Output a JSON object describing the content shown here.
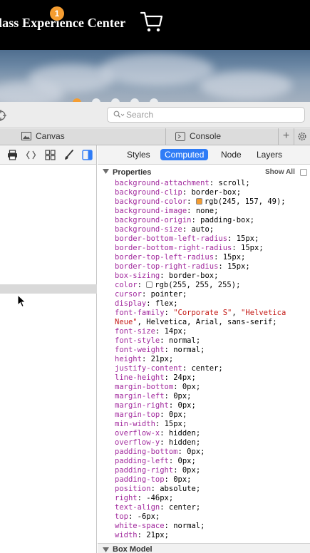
{
  "site": {
    "title": "lass Experience Center",
    "cart_count": "1",
    "cart_icon": "shopping-cart-icon",
    "accent_color": "#f59d31"
  },
  "hero": {
    "carousel_dots": 5,
    "active_dot": 0
  },
  "inspector": {
    "search_placeholder": "Search",
    "tabs": [
      {
        "label": "Canvas",
        "icon": "canvas-icon"
      },
      {
        "label": "Console",
        "icon": "console-icon"
      }
    ],
    "panel_tabs": [
      {
        "label": "Styles"
      },
      {
        "label": "Computed",
        "selected": true
      },
      {
        "label": "Node"
      },
      {
        "label": "Layers"
      }
    ],
    "properties_title": "Properties",
    "show_all_label": "Show All",
    "show_all_checked": false,
    "box_model_label": "Box Model"
  },
  "properties": [
    {
      "name": "background-attachment",
      "value": "scroll"
    },
    {
      "name": "background-clip",
      "value": "border-box"
    },
    {
      "name": "background-color",
      "value": "rgb(245, 157, 49)",
      "swatch": "#f59d31"
    },
    {
      "name": "background-image",
      "value": "none"
    },
    {
      "name": "background-origin",
      "value": "padding-box"
    },
    {
      "name": "background-size",
      "value": "auto"
    },
    {
      "name": "border-bottom-left-radius",
      "value": "15px"
    },
    {
      "name": "border-bottom-right-radius",
      "value": "15px"
    },
    {
      "name": "border-top-left-radius",
      "value": "15px"
    },
    {
      "name": "border-top-right-radius",
      "value": "15px"
    },
    {
      "name": "box-sizing",
      "value": "border-box"
    },
    {
      "name": "color",
      "value": "rgb(255, 255, 255)",
      "swatch": "#ffffff"
    },
    {
      "name": "cursor",
      "value": "pointer"
    },
    {
      "name": "display",
      "value": "flex"
    },
    {
      "name": "font-family",
      "font_parts": [
        {
          "text": "\"Corporate S\"",
          "str": true
        },
        {
          "text": ", ",
          "str": false
        },
        {
          "text": "\"Helvetica Neue\"",
          "str": true
        },
        {
          "text": ", Helvetica, Arial, sans-serif",
          "str": false
        }
      ]
    },
    {
      "name": "font-size",
      "value": "14px"
    },
    {
      "name": "font-style",
      "value": "normal"
    },
    {
      "name": "font-weight",
      "value": "normal"
    },
    {
      "name": "height",
      "value": "21px"
    },
    {
      "name": "justify-content",
      "value": "center"
    },
    {
      "name": "line-height",
      "value": "24px"
    },
    {
      "name": "margin-bottom",
      "value": "0px"
    },
    {
      "name": "margin-left",
      "value": "0px"
    },
    {
      "name": "margin-right",
      "value": "0px"
    },
    {
      "name": "margin-top",
      "value": "0px"
    },
    {
      "name": "min-width",
      "value": "15px"
    },
    {
      "name": "overflow-x",
      "value": "hidden"
    },
    {
      "name": "overflow-y",
      "value": "hidden"
    },
    {
      "name": "padding-bottom",
      "value": "0px"
    },
    {
      "name": "padding-left",
      "value": "0px"
    },
    {
      "name": "padding-right",
      "value": "0px"
    },
    {
      "name": "padding-top",
      "value": "0px"
    },
    {
      "name": "position",
      "value": "absolute"
    },
    {
      "name": "right",
      "value": "-46px"
    },
    {
      "name": "text-align",
      "value": "center"
    },
    {
      "name": "top",
      "value": "-6px"
    },
    {
      "name": "white-space",
      "value": "normal"
    },
    {
      "name": "width",
      "value": "21px"
    }
  ]
}
